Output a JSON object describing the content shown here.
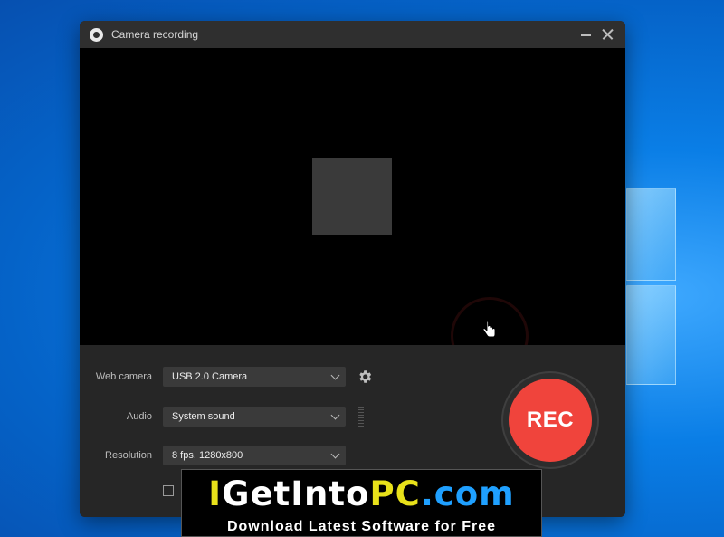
{
  "window": {
    "title": "Camera recording"
  },
  "controls": {
    "webcam_label": "Web camera",
    "webcam_value": "USB 2.0 Camera",
    "audio_label": "Audio",
    "audio_value": "System sound",
    "resolution_label": "Resolution",
    "resolution_value": "8 fps, 1280x800",
    "rec_label": "REC"
  },
  "watermark": {
    "line1_part1": "I",
    "line1_part2": "GetInto",
    "line1_part3": "PC",
    "line1_part4": ".com",
    "line2": "Download Latest Software for Free"
  },
  "colors": {
    "rec": "#f0443c",
    "window_bg": "#262626",
    "desktop": "#0a7ee6"
  },
  "icons": [
    "camera-app-icon",
    "minimize-icon",
    "close-icon",
    "chevron-down-icon",
    "gear-icon",
    "cursor-icon"
  ]
}
